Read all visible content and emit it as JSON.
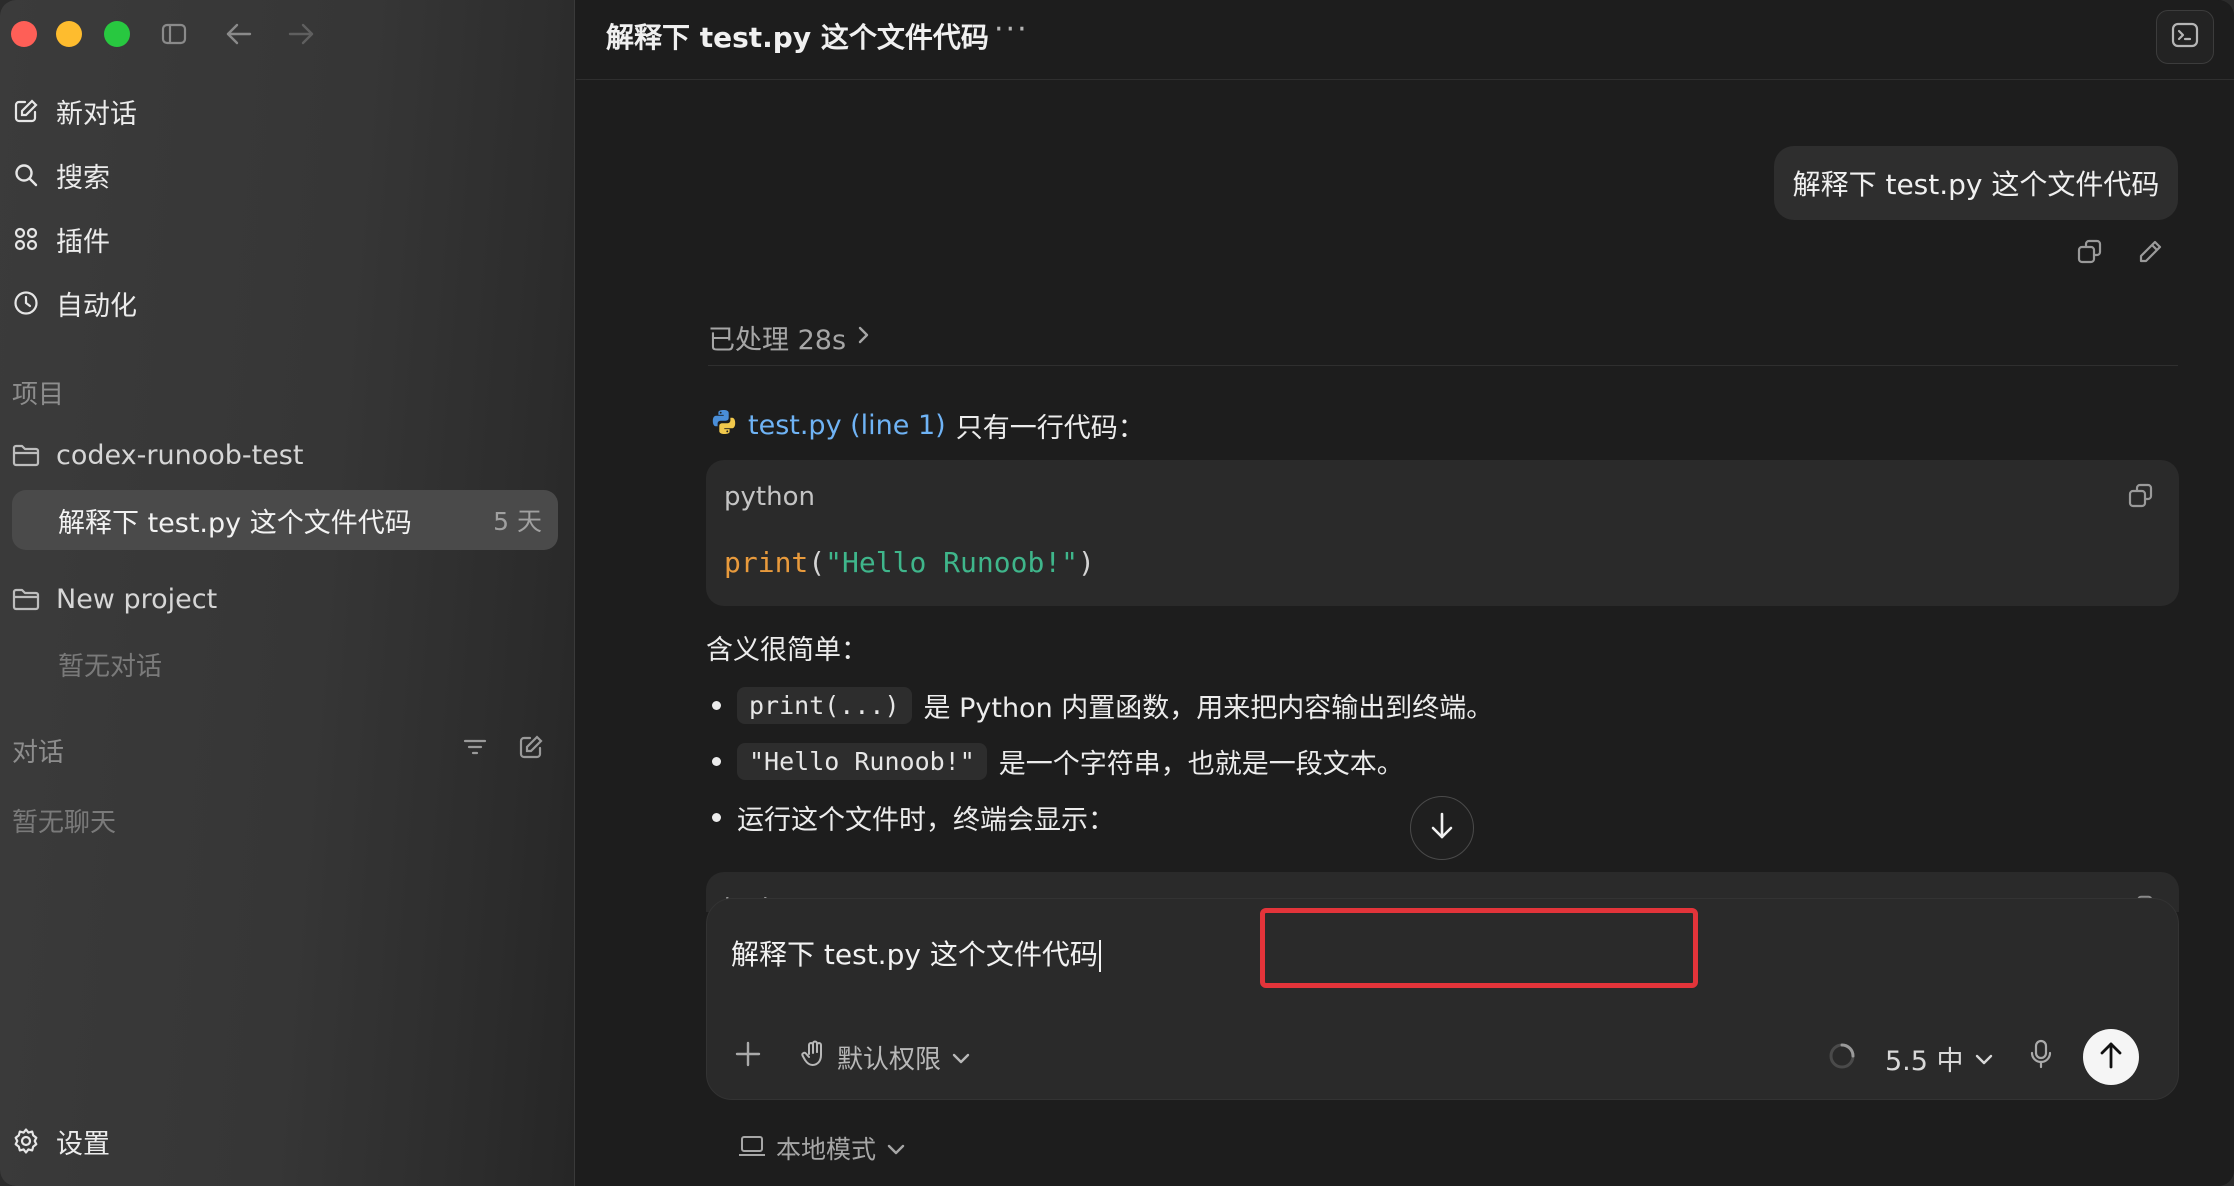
{
  "window": {
    "title": "解释下 test.py 这个文件代码"
  },
  "sidebar": {
    "nav": [
      {
        "label": "新对话",
        "icon": "new-chat-icon"
      },
      {
        "label": "搜索",
        "icon": "search-icon"
      },
      {
        "label": "插件",
        "icon": "plugins-icon"
      },
      {
        "label": "自动化",
        "icon": "clock-icon"
      }
    ],
    "projects_label": "项目",
    "projects": [
      {
        "name": "codex-runoob-test"
      },
      {
        "name": "New project",
        "empty_text": "暂无对话"
      }
    ],
    "active_conversation": {
      "title": "解释下 test.py 这个文件代码",
      "age": "5 天"
    },
    "conversations_label": "对话",
    "conversations_empty": "暂无聊天",
    "settings_label": "设置"
  },
  "chat": {
    "user_message": "解释下 test.py 这个文件代码",
    "processed_label": "已处理 28s",
    "answer_intro_link": "test.py (line 1)",
    "answer_intro_text": "只有一行代码：",
    "code_block": {
      "lang": "python",
      "fn": "print",
      "open": "(",
      "str": "\"Hello Runoob!\"",
      "close": ")"
    },
    "paragraph": "含义很简单：",
    "bullets": [
      {
        "code": "print(...)",
        "text": "是 Python 内置函数，用来把内容输出到终端。"
      },
      {
        "code": "\"Hello Runoob!\"",
        "text": "是一个字符串，也就是一段文本。"
      },
      {
        "code": "",
        "text": "运行这个文件时，终端会显示："
      }
    ],
    "code_block_2_lang": "text"
  },
  "composer": {
    "text": "解释下 test.py 这个文件代码",
    "permission_label": "默认权限",
    "model_label": "5.5 中",
    "mode_label": "本地模式"
  },
  "colors": {
    "accent_link": "#6fb3f5",
    "highlight_border": "#e3343a",
    "code_fn": "#e89a3c",
    "code_string": "#3fb68b"
  }
}
